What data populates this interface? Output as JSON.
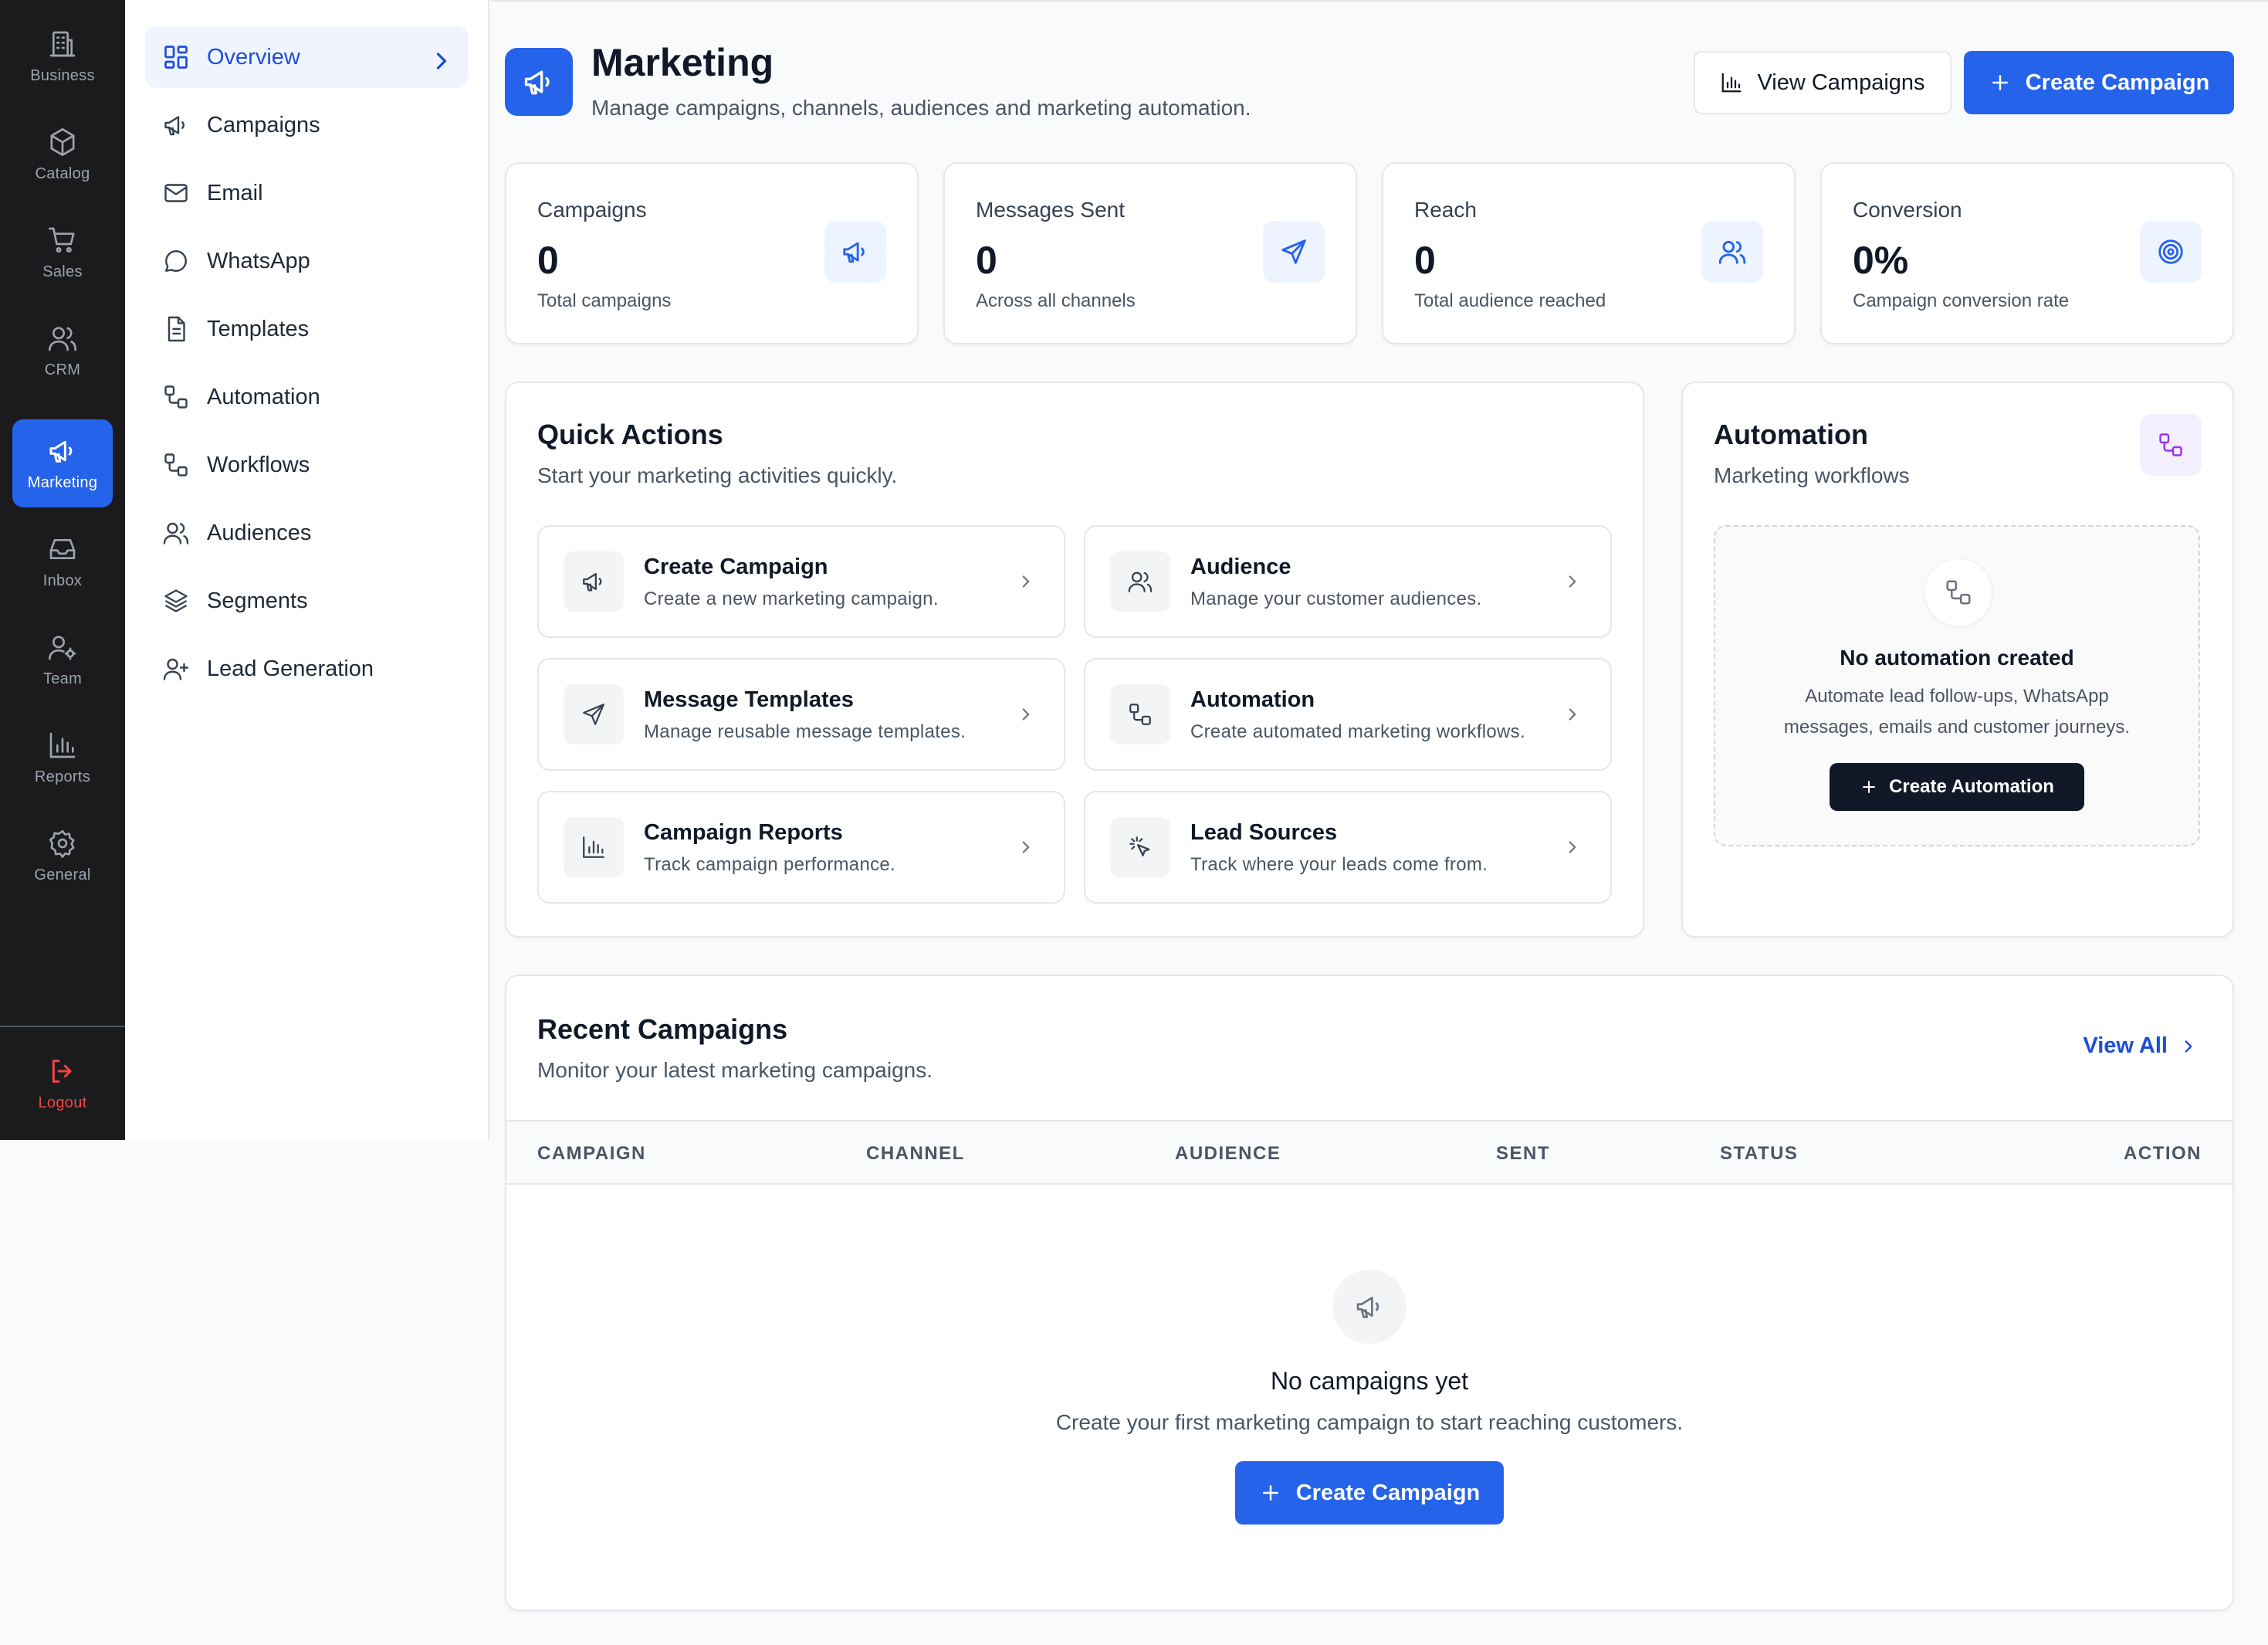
{
  "rail": {
    "items": [
      {
        "label": "Business",
        "icon": "building-icon"
      },
      {
        "label": "Catalog",
        "icon": "box-icon"
      },
      {
        "label": "Sales",
        "icon": "cart-icon"
      },
      {
        "label": "CRM",
        "icon": "users-icon"
      },
      {
        "label": "Marketing",
        "icon": "megaphone-icon"
      },
      {
        "label": "Inbox",
        "icon": "inbox-icon"
      },
      {
        "label": "Team",
        "icon": "user-cog-icon"
      },
      {
        "label": "Reports",
        "icon": "bar-chart-icon"
      },
      {
        "label": "General",
        "icon": "gear-icon"
      }
    ],
    "active": "Marketing",
    "logout_label": "Logout"
  },
  "subnav": {
    "items": [
      {
        "label": "Overview",
        "icon": "grid-icon"
      },
      {
        "label": "Campaigns",
        "icon": "megaphone-icon"
      },
      {
        "label": "Email",
        "icon": "mail-icon"
      },
      {
        "label": "WhatsApp",
        "icon": "chat-icon"
      },
      {
        "label": "Templates",
        "icon": "file-icon"
      },
      {
        "label": "Automation",
        "icon": "workflow-icon"
      },
      {
        "label": "Workflows",
        "icon": "workflow-icon"
      },
      {
        "label": "Audiences",
        "icon": "users-icon"
      },
      {
        "label": "Segments",
        "icon": "layers-icon"
      },
      {
        "label": "Lead Generation",
        "icon": "user-plus-icon"
      }
    ],
    "active": "Overview"
  },
  "header": {
    "title": "Marketing",
    "subtitle": "Manage campaigns, channels, audiences and marketing automation.",
    "view_campaigns_label": "View Campaigns",
    "create_campaign_label": "Create Campaign"
  },
  "stats": [
    {
      "label": "Campaigns",
      "value": "0",
      "desc": "Total campaigns",
      "icon": "megaphone-icon"
    },
    {
      "label": "Messages Sent",
      "value": "0",
      "desc": "Across all channels",
      "icon": "send-icon"
    },
    {
      "label": "Reach",
      "value": "0",
      "desc": "Total audience reached",
      "icon": "users-icon"
    },
    {
      "label": "Conversion",
      "value": "0%",
      "desc": "Campaign conversion rate",
      "icon": "target-icon"
    }
  ],
  "quick_actions": {
    "title": "Quick Actions",
    "subtitle": "Start your marketing activities quickly.",
    "items": [
      {
        "title": "Create Campaign",
        "desc": "Create a new marketing campaign.",
        "icon": "megaphone-icon"
      },
      {
        "title": "Audience",
        "desc": "Manage your customer audiences.",
        "icon": "users-icon"
      },
      {
        "title": "Message Templates",
        "desc": "Manage reusable message templates.",
        "icon": "send-icon"
      },
      {
        "title": "Automation",
        "desc": "Create automated marketing workflows.",
        "icon": "workflow-icon"
      },
      {
        "title": "Campaign Reports",
        "desc": "Track campaign performance.",
        "icon": "bar-chart-icon"
      },
      {
        "title": "Lead Sources",
        "desc": "Track where your leads come from.",
        "icon": "pointer-icon"
      }
    ]
  },
  "automation": {
    "title": "Automation",
    "subtitle": "Marketing workflows",
    "empty_title": "No automation created",
    "empty_desc_line1": "Automate lead follow-ups, WhatsApp",
    "empty_desc_line2": "messages, emails and customer journeys.",
    "button_label": "Create Automation"
  },
  "recent": {
    "title": "Recent Campaigns",
    "subtitle": "Monitor your latest marketing campaigns.",
    "view_all_label": "View All",
    "columns": [
      "CAMPAIGN",
      "CHANNEL",
      "AUDIENCE",
      "SENT",
      "STATUS",
      "ACTION"
    ],
    "empty_title": "No campaigns yet",
    "empty_desc": "Create your first marketing campaign to start reaching customers.",
    "button_label": "Create Campaign"
  },
  "colors": {
    "accent": "#2563eb",
    "rail_bg": "#1b1b1d",
    "logout": "#ef4444",
    "automation_accent": "#9333ea"
  }
}
